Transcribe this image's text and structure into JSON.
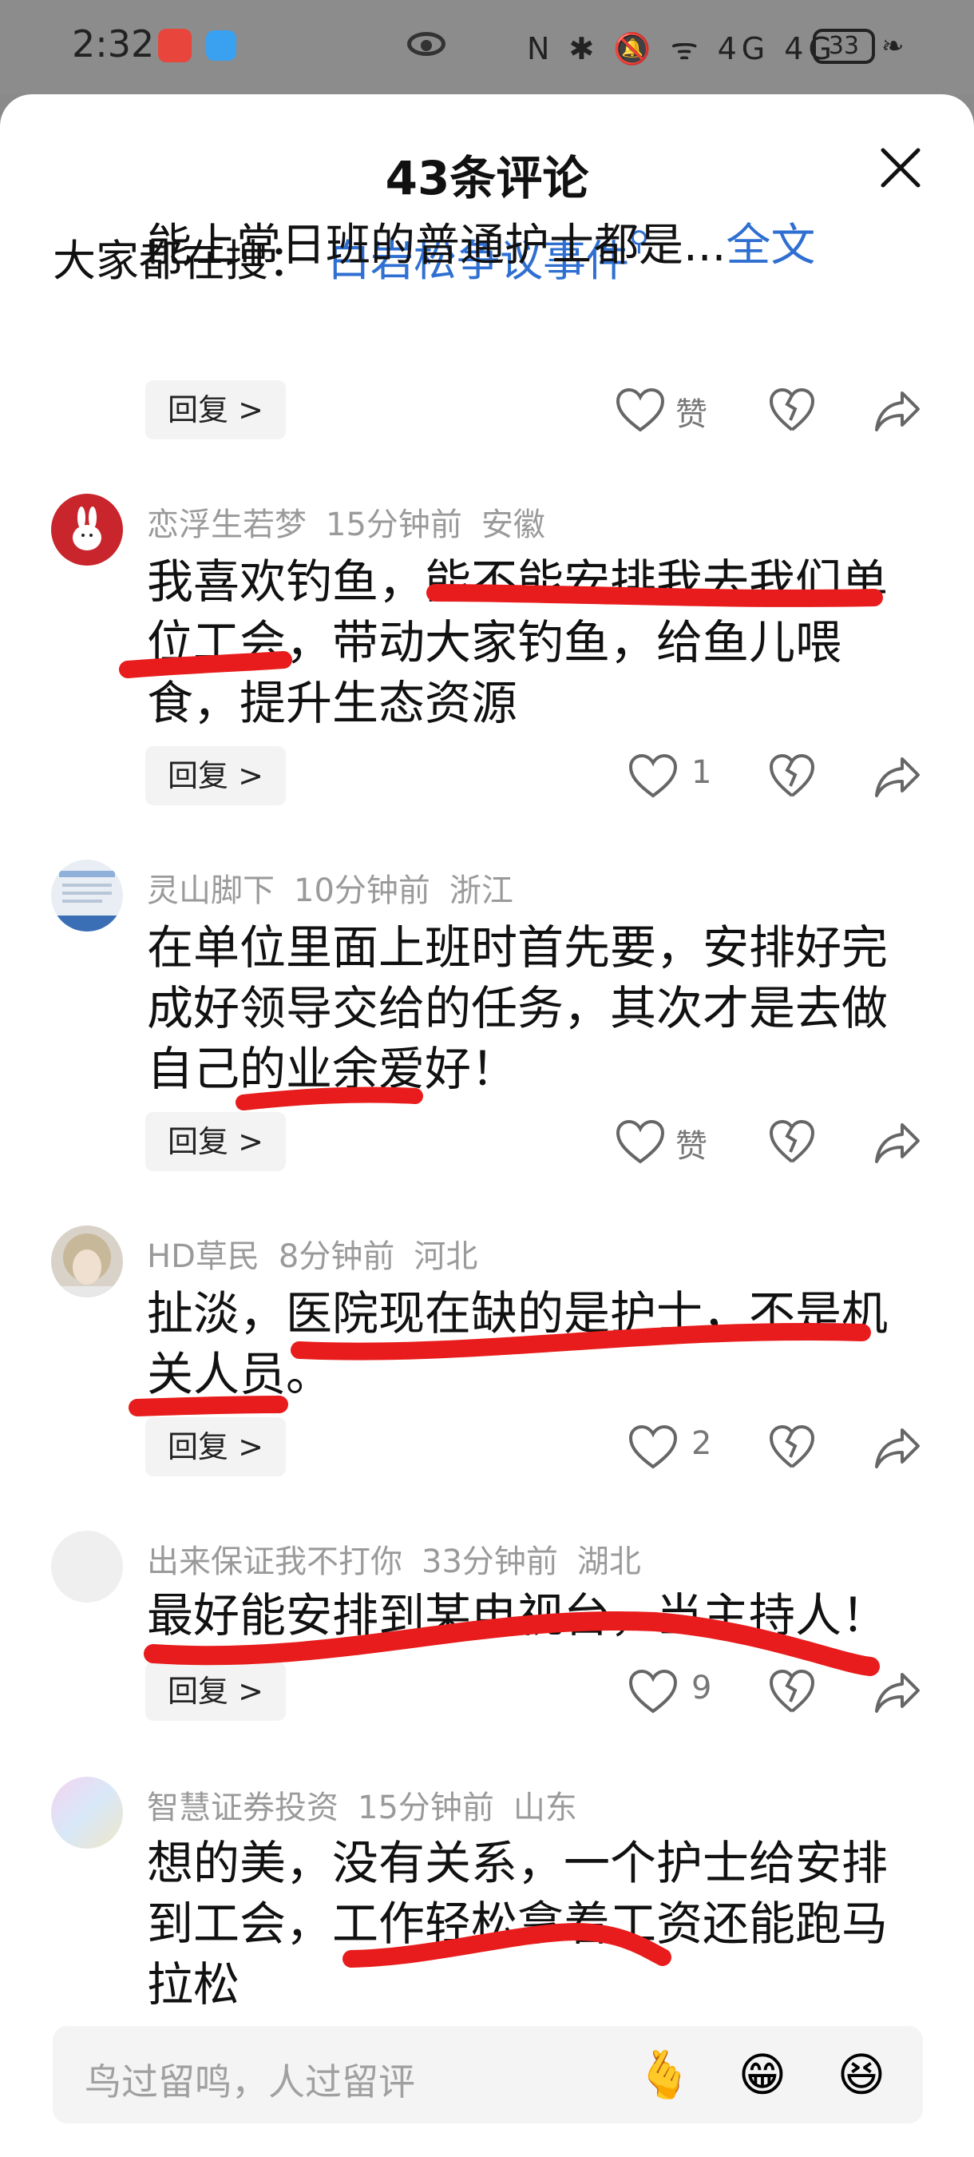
{
  "status_bar": {
    "time": "2:32",
    "icons": "N ✱ 🔕 ᯤ 4G 4G",
    "battery": "33"
  },
  "sheet": {
    "title": "43条评论",
    "search": {
      "prefix": "大家都在搜：",
      "link": "白岩松争议事件"
    }
  },
  "truncated_comment": {
    "text": "能上常日班的普通护士都是...",
    "more": "全文",
    "reply": "回复 >",
    "like_label": "赞"
  },
  "comments": [
    {
      "user": "恋浮生若梦",
      "time": "15分钟前",
      "region": "安徽",
      "lines": [
        "我喜欢钓鱼，能不能安排我去我们单",
        "位工会，带动大家钓鱼，给鱼儿喂",
        "食，提升生态资源"
      ],
      "reply": "回复 >",
      "likes": "1"
    },
    {
      "user": "灵山脚下",
      "time": "10分钟前",
      "region": "浙江",
      "lines": [
        "在单位里面上班时首先要，安排好完",
        "成好领导交给的任务，其次才是去做",
        "自己的业余爱好！"
      ],
      "reply": "回复 >",
      "likes": "赞"
    },
    {
      "user": "HD草民",
      "time": "8分钟前",
      "region": "河北",
      "lines": [
        "扯淡，医院现在缺的是护士，不是机",
        "关人员。"
      ],
      "reply": "回复 >",
      "likes": "2"
    },
    {
      "user": "出来保证我不打你",
      "time": "33分钟前",
      "region": "湖北",
      "lines": [
        "最好能安排到某电视台，当主持人！"
      ],
      "reply": "回复 >",
      "likes": "9"
    },
    {
      "user": "智慧证券投资",
      "time": "15分钟前",
      "region": "山东",
      "lines": [
        "想的美，没有关系，一个护士给安排",
        "到工会，工作轻松拿着工资还能跑马",
        "拉松"
      ]
    }
  ],
  "input": {
    "placeholder": "鸟过留鸣，人过留评"
  },
  "emojis": [
    "🫰",
    "😁",
    "😆"
  ]
}
